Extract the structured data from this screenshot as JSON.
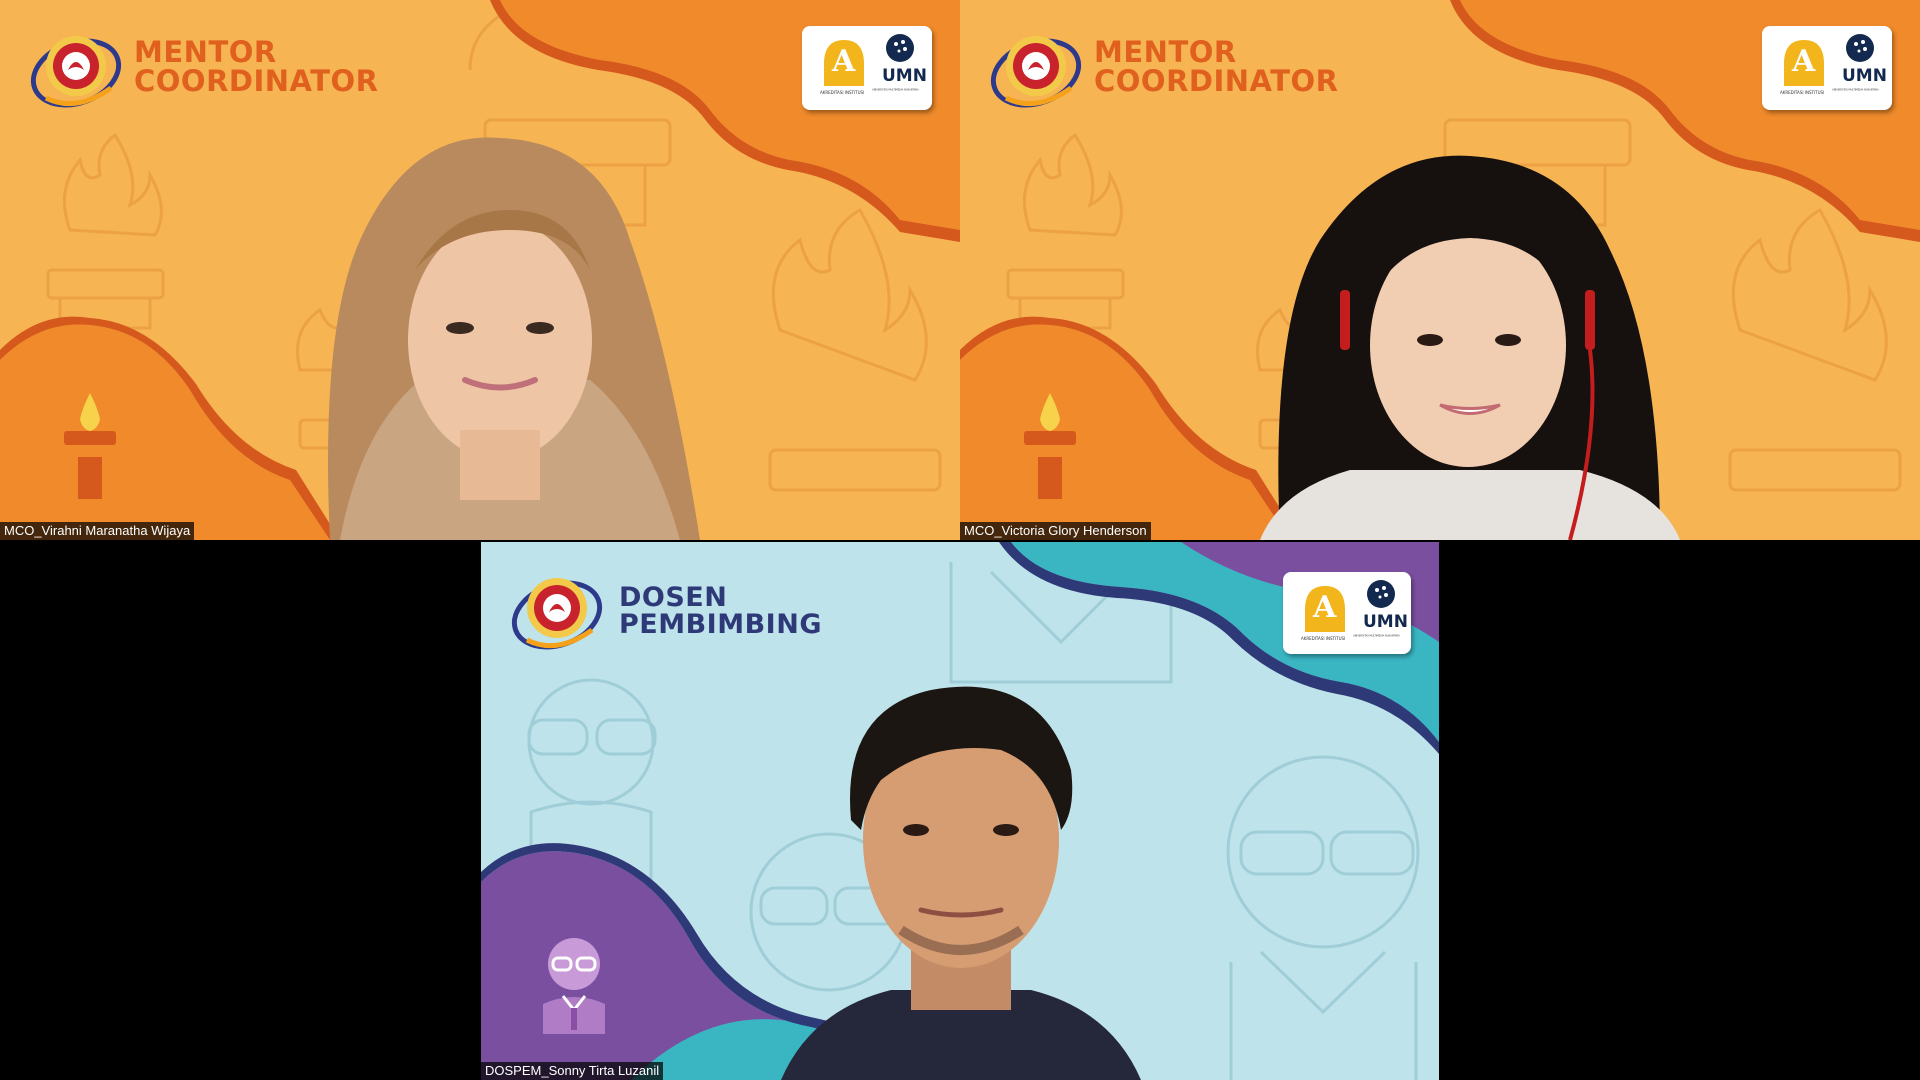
{
  "colors": {
    "mentor_bg": "#f6b453",
    "mentor_wave": "#f08a2a",
    "mentor_wave_dark": "#d5581c",
    "mentor_title": "#e0601e",
    "dosen_bg": "#bfe3ea",
    "dosen_wave_teal": "#3ab6c3",
    "dosen_wave_purple": "#7a4fa0",
    "dosen_title": "#2e3a78",
    "umn_navy": "#13294f",
    "accredit_gold": "#f2b51c"
  },
  "participants": [
    {
      "display_name": "MCO_Virahni Maranatha Wijaya",
      "background_title": [
        "MENTOR",
        "COORDINATOR"
      ],
      "icon": "torch-icon"
    },
    {
      "display_name": "MCO_Victoria Glory Henderson",
      "background_title": [
        "MENTOR",
        "COORDINATOR"
      ],
      "icon": "torch-icon"
    },
    {
      "display_name": "DOSPEM_Sonny Tirta Luzanil",
      "background_title": [
        "DOSEN",
        "PEMBIMBING"
      ],
      "icon": "lecturer-icon"
    }
  ],
  "badge": {
    "accreditation_letter": "A",
    "accreditation_caption": "AKREDITASI INSTITUSI",
    "university_short": "UMN",
    "university_caption": "UNIVERSITAS MULTIMEDIA NUSANTARA"
  }
}
